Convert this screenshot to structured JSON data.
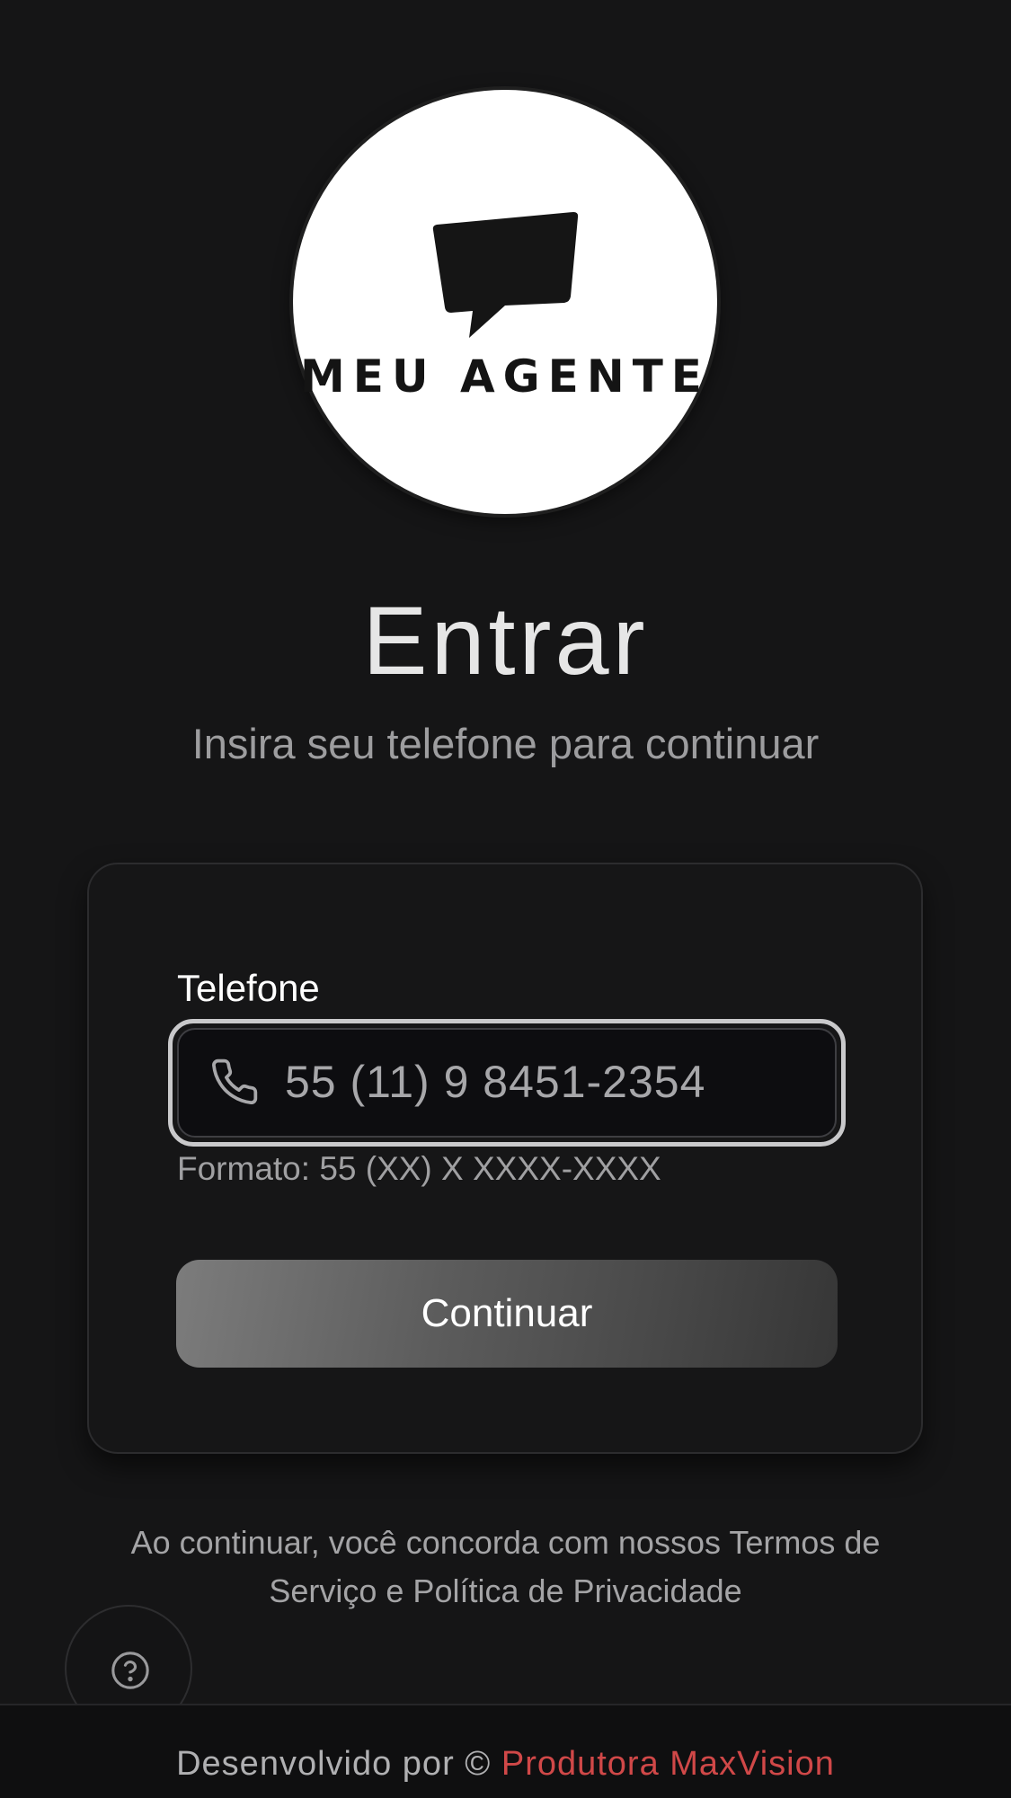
{
  "logo": {
    "brand_name": "MEU AGENTE",
    "icon": "speech-bubble-icon"
  },
  "header": {
    "title": "Entrar",
    "subtitle": "Insira seu telefone para continuar"
  },
  "form": {
    "phone_label": "Telefone",
    "phone_value": "55 (11) 9 8451-2354",
    "phone_icon": "phone-icon",
    "format_hint": "Formato: 55 (XX) X XXXX-XXXX",
    "continue_label": "Continuar"
  },
  "terms": {
    "line1": "Ao continuar, você concorda com nossos Termos de",
    "line2": "Serviço e Política de Privacidade"
  },
  "help": {
    "icon": "help-circle-icon"
  },
  "footer": {
    "prefix": "Desenvolvido por ©",
    "company": "Produtora MaxVision",
    "company_color": "#d04848"
  }
}
